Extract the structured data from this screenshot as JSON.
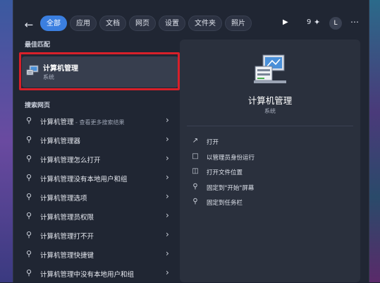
{
  "tabs": [
    "全部",
    "应用",
    "文档",
    "网页",
    "设置",
    "文件夹",
    "照片"
  ],
  "top_right": {
    "count": "9",
    "avatar_letter": "L"
  },
  "best_match": {
    "heading": "最佳匹配",
    "title": "计算机管理",
    "subtitle": "系统"
  },
  "web_search": {
    "heading": "搜索网页",
    "items": [
      {
        "text": "计算机管理",
        "sub": " - 查看更多搜索结果"
      },
      {
        "text": "计算机管理器",
        "sub": ""
      },
      {
        "text": "计算机管理怎么打开",
        "sub": ""
      },
      {
        "text": "计算机管理没有本地用户和组",
        "sub": ""
      },
      {
        "text": "计算机管理选项",
        "sub": ""
      },
      {
        "text": "计算机管理员权限",
        "sub": ""
      },
      {
        "text": "计算机管理打不开",
        "sub": ""
      },
      {
        "text": "计算机管理快捷键",
        "sub": ""
      },
      {
        "text": "计算机管理中没有本地用户和组",
        "sub": ""
      }
    ]
  },
  "detail": {
    "title": "计算机管理",
    "subtitle": "系统",
    "actions": [
      {
        "icon": "open-icon",
        "label": "打开"
      },
      {
        "icon": "admin-shield-icon",
        "label": "以管理员身份运行"
      },
      {
        "icon": "folder-icon",
        "label": "打开文件位置"
      },
      {
        "icon": "pin-icon",
        "label": "固定到\"开始\"屏幕"
      },
      {
        "icon": "pin-icon",
        "label": "固定到任务栏"
      }
    ]
  },
  "colors": {
    "accent": "#3b7fe0",
    "highlight_outline": "#d8202a"
  }
}
